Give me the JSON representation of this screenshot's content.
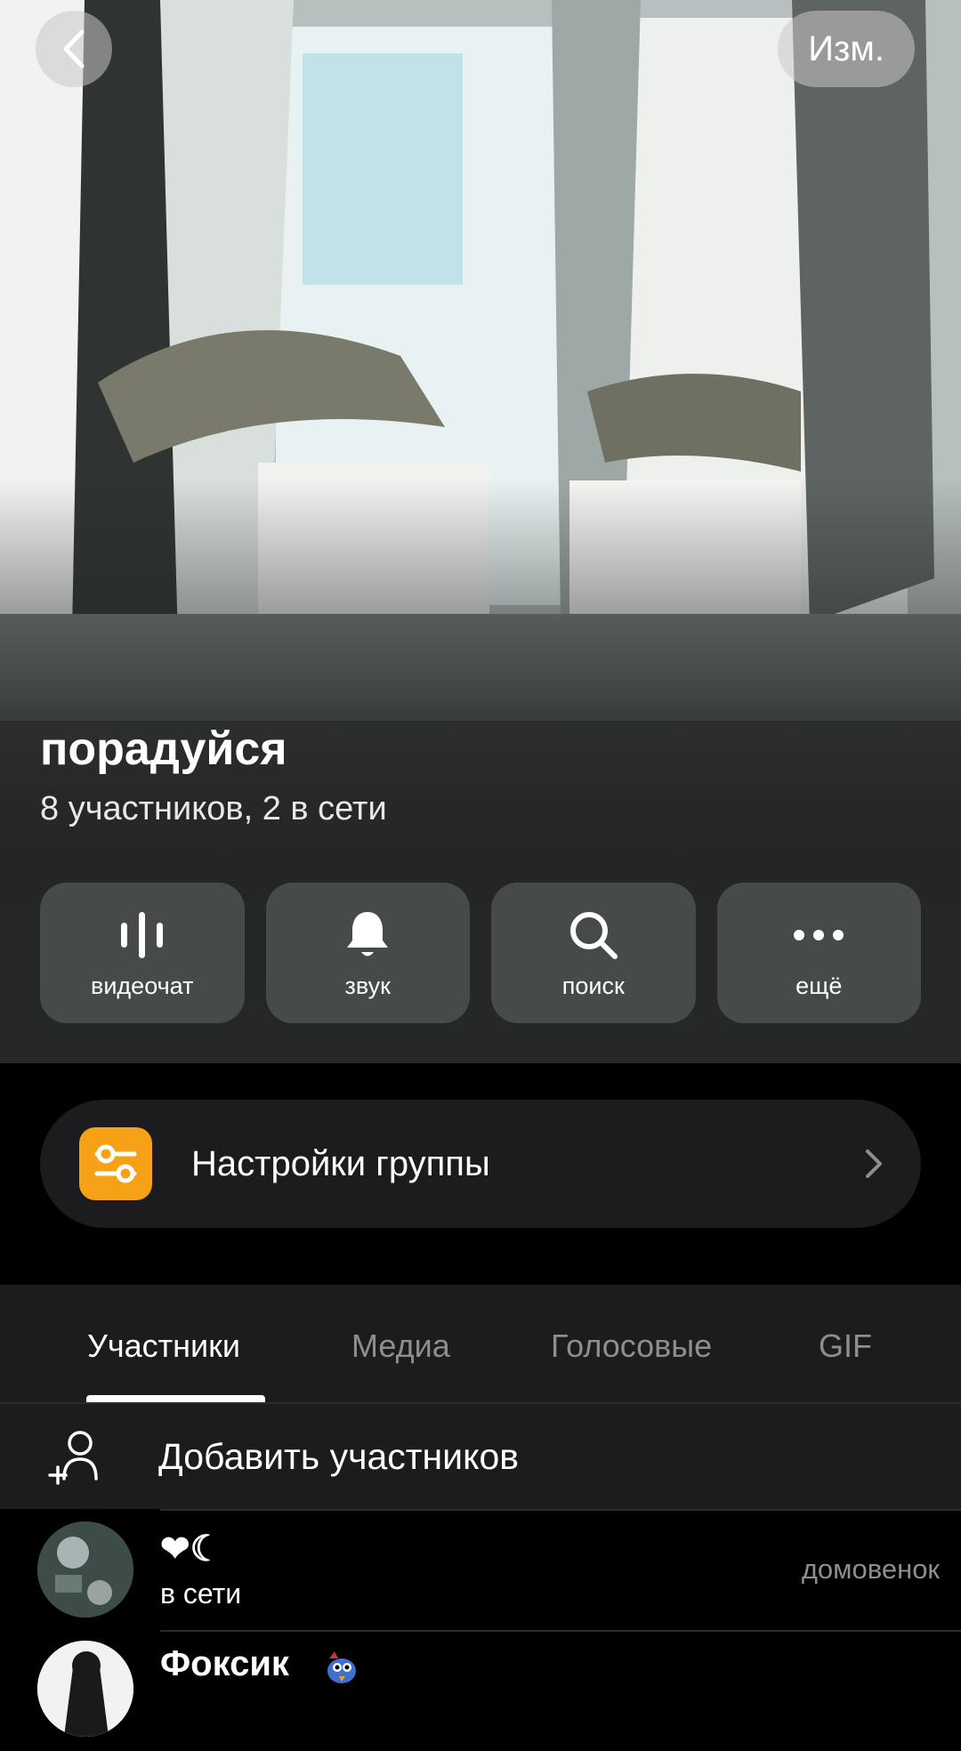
{
  "header": {
    "back_icon": "chevron-left-icon",
    "edit_label": "Изм."
  },
  "group": {
    "title": "порадуйся",
    "subtitle": "8 участников, 2 в сети"
  },
  "actions": [
    {
      "label": "видеочат",
      "icon": "voice-bars-icon"
    },
    {
      "label": "звук",
      "icon": "bell-icon"
    },
    {
      "label": "поиск",
      "icon": "search-icon"
    },
    {
      "label": "ещё",
      "icon": "more-dots-icon"
    }
  ],
  "settings": {
    "label": "Настройки группы",
    "icon": "sliders-icon",
    "icon_color": "#f7a116"
  },
  "tabs": [
    {
      "label": "Участники",
      "active": true
    },
    {
      "label": "Медиа",
      "active": false
    },
    {
      "label": "Голосовые",
      "active": false
    },
    {
      "label": "GIF",
      "active": false
    }
  ],
  "add_members": {
    "label": "Добавить участников",
    "icon": "add-user-icon"
  },
  "members": [
    {
      "name": "❤☾",
      "status": "в сети",
      "role": "домовенок"
    },
    {
      "name": "Фоксик",
      "status": "",
      "role": ""
    }
  ]
}
